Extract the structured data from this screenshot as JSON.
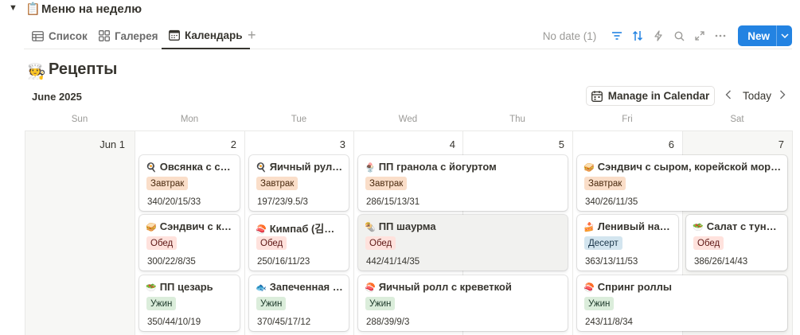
{
  "database": {
    "toggle": "▼",
    "emoji": "📋",
    "title": "Меню на неделю"
  },
  "views": [
    {
      "label": "Список",
      "icon": "table-icon"
    },
    {
      "label": "Галерея",
      "icon": "gallery-icon"
    },
    {
      "label": "Календарь",
      "icon": "calendar-icon",
      "active": true
    }
  ],
  "add_view": "+",
  "toolbar": {
    "no_date": "No date (1)",
    "new_label": "New",
    "accent": "#2383e2"
  },
  "page": {
    "icon": "🧑‍🍳",
    "title": "Рецепты"
  },
  "calendar": {
    "month": "June 2025",
    "manage_label": "Manage in Calendar",
    "today_label": "Today",
    "weekdays": [
      "Sun",
      "Mon",
      "Tue",
      "Wed",
      "Thu",
      "Fri",
      "Sat"
    ],
    "day_numbers": [
      "Jun 1",
      "2",
      "3",
      "4",
      "5",
      "6",
      "7"
    ]
  },
  "tag_colors": {
    "breakfast": "#fadec9",
    "lunch": "#ffe2dd",
    "dinner": "#dbeddb",
    "dessert": "#d3e5ef"
  },
  "events": [
    {
      "emoji": "🍳",
      "title": "Овсянка с сыром",
      "tag": "Завтрак",
      "tag_type": "breakfast",
      "macros": "340/20/15/33"
    },
    {
      "emoji": "🍳",
      "title": "Яичный рулет с сыром",
      "tag": "Завтрак",
      "tag_type": "breakfast",
      "macros": "197/23/9.5/3"
    },
    {
      "emoji": "🍨",
      "title": "ПП гранола с йогуртом",
      "tag": "Завтрак",
      "tag_type": "breakfast",
      "macros": "286/15/13/31"
    },
    {
      "emoji": "🥪",
      "title": "Сэндвич с сыром, корейской морковкой",
      "tag": "Завтрак",
      "tag_type": "breakfast",
      "macros": "340/26/11/35"
    },
    {
      "emoji": "🥪",
      "title": "Сэндвич с курицей",
      "tag": "Обед",
      "tag_type": "lunch",
      "macros": "300/22/8/35"
    },
    {
      "emoji": "🍣",
      "title": "Кимпаб (김밥) с тунцом",
      "tag": "Обед",
      "tag_type": "lunch",
      "macros": "250/16/11/23"
    },
    {
      "emoji": "🌯",
      "title": "ПП шаурма",
      "tag": "Обед",
      "tag_type": "lunch",
      "macros": "442/41/14/35"
    },
    {
      "emoji": "🍰",
      "title": "Ленивый наполеон",
      "tag": "Десерт",
      "tag_type": "dessert",
      "macros": "363/13/11/53"
    },
    {
      "emoji": "🥗",
      "title": "Салат с тунцом",
      "tag": "Обед",
      "tag_type": "lunch",
      "macros": "386/26/14/43"
    },
    {
      "emoji": "🥗",
      "title": "ПП цезарь",
      "tag": "Ужин",
      "tag_type": "dinner",
      "macros": "350/44/10/19"
    },
    {
      "emoji": "🐟",
      "title": "Запеченная скумбрия",
      "tag": "Ужин",
      "tag_type": "dinner",
      "macros": "370/45/17/12"
    },
    {
      "emoji": "🍣",
      "title": "Яичный ролл с креветкой",
      "tag": "Ужин",
      "tag_type": "dinner",
      "macros": "288/39/9/3"
    },
    {
      "emoji": "🍣",
      "title": "Спринг роллы",
      "tag": "Ужин",
      "tag_type": "dinner",
      "macros": "243/11/8/34"
    }
  ]
}
